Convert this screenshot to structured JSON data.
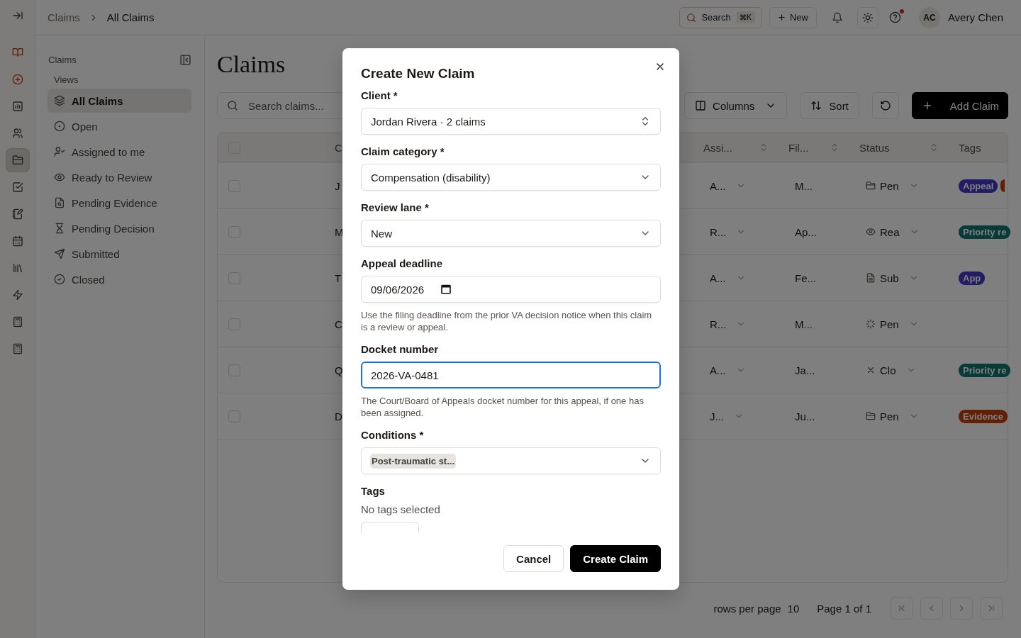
{
  "rail": [
    {
      "selected": false
    },
    {
      "selected": false,
      "color": "#612006"
    },
    {
      "selected": false,
      "color": "#612006"
    },
    {
      "selected": false
    },
    {
      "selected": false
    },
    {
      "selected": true
    },
    {
      "selected": false
    },
    {
      "selected": false
    },
    {
      "selected": false
    },
    {
      "selected": false
    },
    {
      "selected": false
    },
    {
      "selected": false
    },
    {
      "selected": false
    }
  ],
  "topbar": {
    "breadcrumb": [
      "Claims",
      "All Claims"
    ],
    "search": {
      "label": "Search",
      "shortcut": "⌘K"
    },
    "new_label": "New",
    "help_dot": true,
    "user": {
      "initials": "AC",
      "name": "Avery Chen"
    }
  },
  "sidebar": {
    "title": "Claims",
    "section": "Views",
    "items": [
      {
        "label": "All Claims",
        "selected": true
      },
      {
        "label": "Open",
        "selected": false
      },
      {
        "label": "Assigned to me",
        "selected": false
      },
      {
        "label": "Ready to Review",
        "selected": false
      },
      {
        "label": "Pending Evidence",
        "selected": false
      },
      {
        "label": "Pending Decision",
        "selected": false
      },
      {
        "label": "Submitted",
        "selected": false
      },
      {
        "label": "Closed",
        "selected": false
      }
    ]
  },
  "main": {
    "title": "Claims",
    "search_placeholder": "Search claims...",
    "columns_label": "Columns",
    "sort_label": "Sort",
    "add_label": "Add Claim",
    "table": {
      "header_checked": false,
      "columns": [
        {
          "label": "C",
          "sortable": false
        },
        {
          "label": "Assi...",
          "sortable": true
        },
        {
          "label": "Fil...",
          "sortable": true
        },
        {
          "label": "Status",
          "sortable": true
        },
        {
          "label": "Tags",
          "sortable": false
        }
      ],
      "rows": [
        {
          "checked": false,
          "name": "J",
          "assignee": "A...",
          "filed": "M...",
          "status": {
            "kind": "folder",
            "text": "Pen"
          },
          "tags": [
            {
              "label": "Appeal",
              "color": "#221c65"
            },
            {
              "color": "#612006"
            }
          ]
        },
        {
          "checked": false,
          "name": "M",
          "assignee": "R...",
          "filed": "Ap...",
          "status": {
            "kind": "eye",
            "text": "Rea"
          },
          "tags": [
            {
              "label": "Priority re",
              "color": "#083b37"
            }
          ]
        },
        {
          "checked": false,
          "name": "T",
          "assignee": "A...",
          "filed": "Fe...",
          "status": {
            "kind": "document",
            "text": "Sub"
          },
          "tags": [
            {
              "label": "App",
              "color": "#221c65"
            }
          ]
        },
        {
          "checked": false,
          "name": "C",
          "assignee": "R...",
          "filed": "M...",
          "status": {
            "kind": "loader",
            "text": "Pen"
          },
          "tags": []
        },
        {
          "checked": false,
          "name": "Q",
          "assignee": "A...",
          "filed": "Ja...",
          "status": {
            "kind": "close",
            "text": "Clo"
          },
          "tags": [
            {
              "label": "Priority re",
              "color": "#083b37"
            }
          ]
        },
        {
          "checked": false,
          "name": "D",
          "assignee": "J...",
          "filed": "Ju...",
          "status": {
            "kind": "folder",
            "text": "Pen"
          },
          "tags": [
            {
              "label": "Evidence",
              "color": "#612006"
            }
          ]
        }
      ]
    },
    "pagination": {
      "rows_label": "rows per page",
      "rows_value": "10",
      "page": "Page 1 of 1"
    }
  },
  "dialog": {
    "title": "Create New Claim",
    "fields": [
      {
        "kind": "combobox",
        "label": "Client *",
        "value": "Jordan Rivera · 2 claims"
      },
      {
        "kind": "select",
        "label": "Claim category *",
        "value": "Compensation (disability)"
      },
      {
        "kind": "select",
        "label": "Review lane *",
        "value": "New"
      },
      {
        "kind": "date",
        "label": "Appeal deadline",
        "value": "09/06/2026",
        "hint": "Use the filing deadline from the prior VA decision notice when this claim is a review or appeal."
      },
      {
        "kind": "text",
        "label": "Docket number",
        "value": "2026-VA-0481",
        "focused": true,
        "hint": "The Court/Board of Appeals docket number for this appeal, if one has been assigned."
      },
      {
        "kind": "multiselect",
        "label": "Conditions *",
        "chips": [
          "Post-traumatic st..."
        ]
      },
      {
        "kind": "tags",
        "label": "Tags",
        "empty_text": "No tags selected"
      }
    ],
    "cancel_label": "Cancel",
    "submit_label": "Create Claim"
  }
}
